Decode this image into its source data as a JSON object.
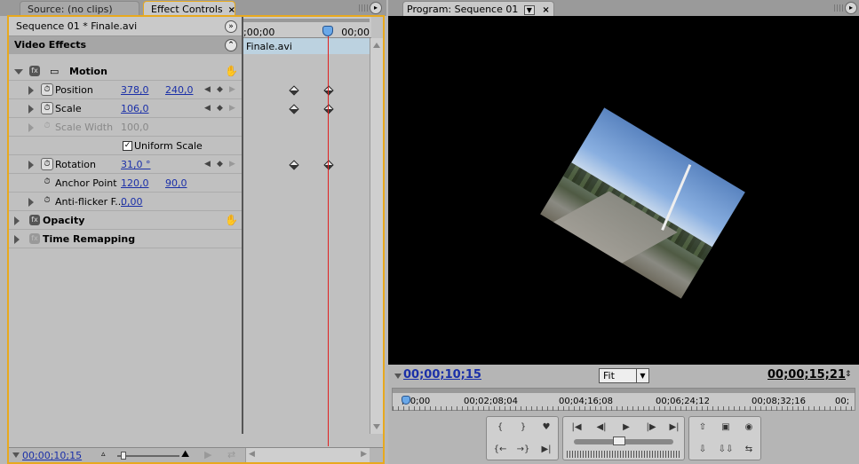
{
  "left_tabs": {
    "source": "Source: (no clips)",
    "effect_controls": "Effect Controls",
    "close": "×"
  },
  "effect_controls": {
    "clip_title": "Sequence 01 * Finale.avi",
    "video_effects": "Video Effects",
    "ruler_start": ";00;00",
    "ruler_end": "00;00",
    "clip_name": "Finale.avi",
    "rows": {
      "motion": {
        "label": "Motion"
      },
      "position": {
        "label": "Position",
        "v1": "378,0",
        "v2": "240,0"
      },
      "scale": {
        "label": "Scale",
        "v1": "106,0"
      },
      "scale_width": {
        "label": "Scale Width",
        "v1": "100,0"
      },
      "uniform_scale": {
        "label": "Uniform Scale",
        "checked": "✓"
      },
      "rotation": {
        "label": "Rotation",
        "v1": "31,0 °"
      },
      "anchor_point": {
        "label": "Anchor Point",
        "v1": "120,0",
        "v2": "90,0"
      },
      "anti_flicker": {
        "label": "Anti-flicker F...",
        "v1": "0,00"
      },
      "opacity": {
        "label": "Opacity"
      },
      "time_remapping": {
        "label": "Time Remapping"
      }
    },
    "footer_timecode": "00;00;10;15"
  },
  "program": {
    "tab_label": "Program: Sequence 01",
    "close": "×",
    "current_timecode": "00;00;10;15",
    "fit_label": "Fit",
    "duration_timecode": "00;00;15;21",
    "ruler_ticks": [
      ";00;00",
      "00;02;08;04",
      "00;04;16;08",
      "00;06;24;12",
      "00;08;32;16",
      "00;"
    ]
  },
  "icons": {
    "fx": "fx",
    "stopwatch": "⏱",
    "reset": "↺",
    "panel_menu": "▸",
    "double_arrow": "»",
    "collapse": "⌃"
  },
  "colors": {
    "accent_border": "#e8a91e",
    "timecode_blue": "#1a2fa8",
    "playhead_red": "#e02020",
    "clip_bar": "#bcd2e0"
  }
}
